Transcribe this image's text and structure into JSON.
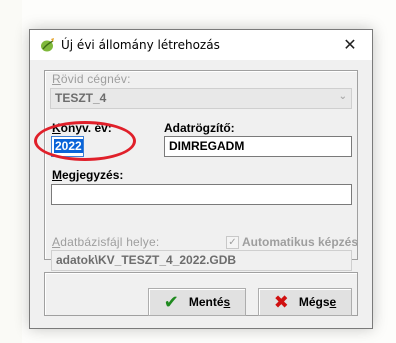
{
  "window": {
    "title": "Új évi állomány létrehozás",
    "close_glyph": "✕",
    "app_icon": "leaf-icon"
  },
  "form": {
    "short_company_label_u": "R",
    "short_company_label_rest": "övid cégnév:",
    "short_company_value": "TESZT_4",
    "fiscal_year_label_u": "K",
    "fiscal_year_label_rest": "önyv. év:",
    "fiscal_year_value": "2022",
    "recorder_label": "Adatrögzítő:",
    "recorder_value": "DIMREGADM",
    "note_label_u": "M",
    "note_label_rest": "egjegyzés:",
    "note_value": "",
    "db_path_label_u": "A",
    "db_path_label_rest": "datbázisfájl helye:",
    "auto_create_label": "Automatikus képzés",
    "auto_create_checked": true,
    "db_path_value": "adatok\\KV_TESZT_4_2022.GDB"
  },
  "buttons": {
    "save_label_main": "Menté",
    "save_label_u": "s",
    "cancel_label_main": "Mégs",
    "cancel_label_u": "e"
  },
  "colors": {
    "highlight_ellipse": "#e0202a",
    "selection": "#0a64d8",
    "save_icon": "#1f8a1f",
    "cancel_icon": "#d01010"
  }
}
